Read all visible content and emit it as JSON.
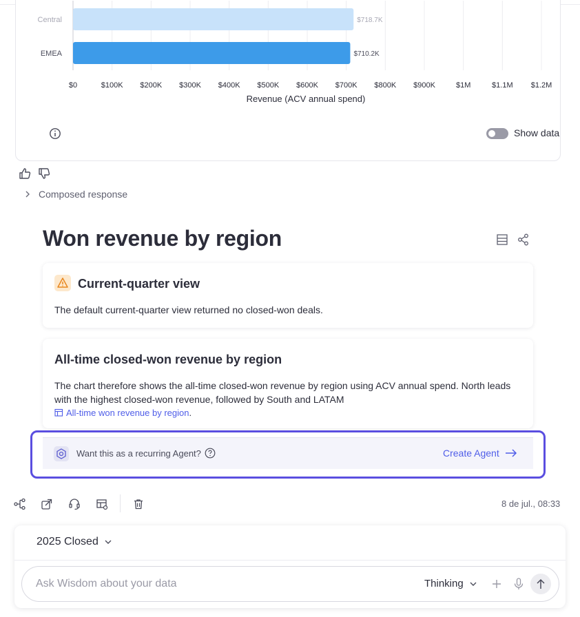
{
  "chart_data": {
    "type": "bar",
    "orientation": "horizontal",
    "categories": [
      "Central",
      "EMEA"
    ],
    "values": [
      718.7,
      710.2
    ],
    "data_labels": [
      "$718.7K",
      "$710.2K"
    ],
    "xlabel": "Revenue (ACV annual spend)",
    "xlim": [
      0,
      1200
    ],
    "ticks": [
      0,
      100,
      200,
      300,
      400,
      500,
      600,
      700,
      800,
      900,
      1000,
      1100,
      1200
    ],
    "tick_labels": [
      "$0",
      "$100K",
      "$200K",
      "$300K",
      "$400K",
      "$500K",
      "$600K",
      "$700K",
      "$800K",
      "$900K",
      "$1M",
      "$1.1M",
      "$1.2M"
    ],
    "grid": true,
    "colors": {
      "faded": "#c8e2fa",
      "active": "#3d9be9"
    }
  },
  "chart_controls": {
    "show_data_label": "Show data",
    "show_data_on": false
  },
  "response": {
    "composed_label": "Composed response",
    "title": "Won revenue by region",
    "warning": {
      "heading": "Current-quarter view",
      "text": "The default current-quarter view returned no closed-won deals."
    },
    "summary": {
      "heading": "All-time closed-won revenue by region",
      "text": "The chart therefore shows the all-time closed-won revenue by region using ACV annual spend. North leads with the highest closed-won revenue, followed by South and LATAM",
      "link_label": "All-time won revenue by region",
      "link_suffix": "."
    },
    "agent": {
      "prompt": "Want this as a recurring Agent?",
      "cta": "Create Agent"
    },
    "timestamp": "8 de jul., 08:33"
  },
  "composer": {
    "scope": "2025 Closed",
    "placeholder": "Ask Wisdom about your data",
    "mode": "Thinking"
  },
  "colors": {
    "accent": "#4f5de8",
    "highlight_outline": "#5a4ee0",
    "warning_bg": "#fde8cc",
    "warning_fg": "#e8871e"
  }
}
